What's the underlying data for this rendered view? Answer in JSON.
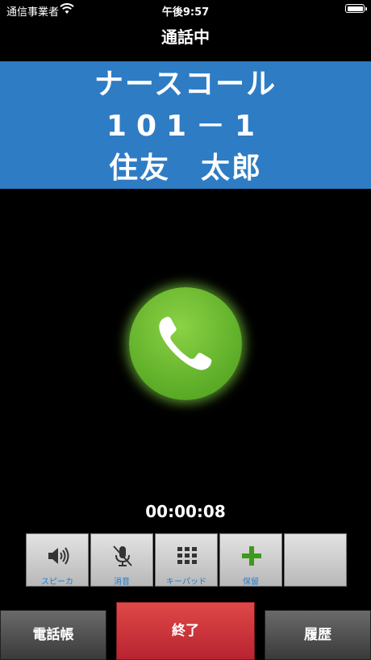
{
  "status_bar": {
    "carrier": "通信事業者",
    "time": "午後9:57"
  },
  "header": {
    "title": "通話中"
  },
  "caller": {
    "line1": "ナースコール",
    "line2": "101－1",
    "line3": "住友　太郎"
  },
  "call_indicator": {
    "icon": "phone-handset-icon",
    "color": "#62b12b"
  },
  "timer": "00:00:08",
  "function_buttons": [
    {
      "label": "スピーカ",
      "icon": "speaker-icon"
    },
    {
      "label": "消音",
      "icon": "mute-microphone-icon"
    },
    {
      "label": "キーパッド",
      "icon": "keypad-icon"
    },
    {
      "label": "保留",
      "icon": "plus-icon"
    },
    {
      "label": "",
      "icon": ""
    }
  ],
  "bottom": {
    "phonebook": "電話帳",
    "end": "終了",
    "history": "履歴"
  },
  "colors": {
    "banner": "#2e7cc4",
    "end_button": "#d43a3f",
    "label_blue": "#1d7fd1",
    "hold_green": "#3d9a1d"
  }
}
